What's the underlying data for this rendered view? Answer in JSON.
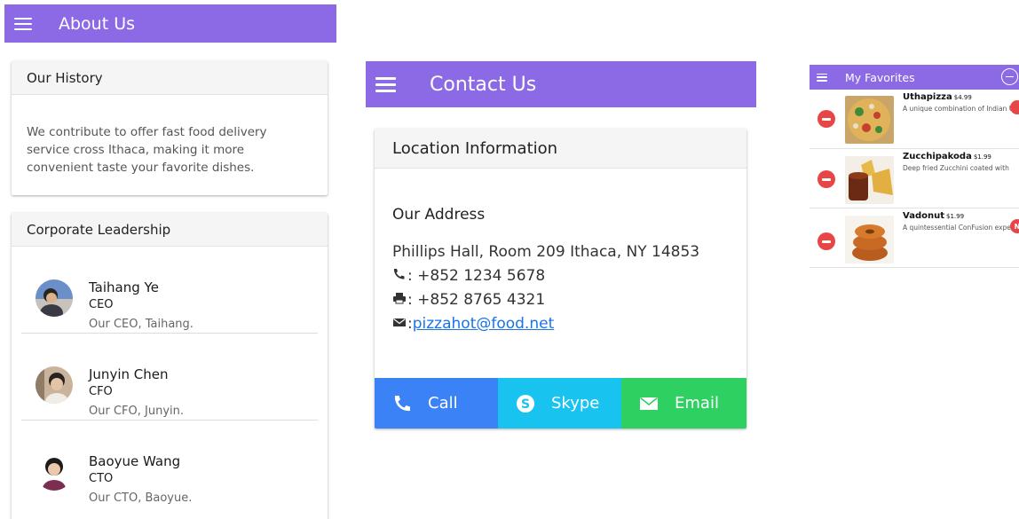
{
  "about": {
    "title": "About Us",
    "history": {
      "header": "Our History",
      "text": "We contribute to offer fast food delivery service cross Ithaca, making it more convenient taste your favorite dishes."
    },
    "leadership": {
      "header": "Corporate Leadership",
      "leaders": [
        {
          "name": "Taihang Ye",
          "role": "CEO",
          "description": "Our CEO, Taihang."
        },
        {
          "name": "Junyin Chen",
          "role": "CFO",
          "description": "Our CFO, Junyin."
        },
        {
          "name": "Baoyue Wang",
          "role": "CTO",
          "description": "Our CTO, Baoyue."
        }
      ]
    }
  },
  "contact": {
    "title": "Contact Us",
    "card_header": "Location Information",
    "address_heading": "Our Address",
    "address": "Phillips Hall, Room 209 Ithaca, NY 14853",
    "phone": ": +852 1234 5678",
    "fax": ": +852 8765 4321",
    "email_prefix": ":",
    "email": "pizzahot@food.net",
    "buttons": {
      "call": "Call",
      "skype": "Skype",
      "email": "Email"
    },
    "colors": {
      "call": "#3b82f6",
      "skype": "#18c3ef",
      "email": "#2ed061"
    }
  },
  "favorites": {
    "title": "My Favorites",
    "items": [
      {
        "name": "Uthapizza",
        "price": "$4.99",
        "description": "A unique combination of Indian Uthappam",
        "badge": ""
      },
      {
        "name": "Zucchipakoda",
        "price": "$1.99",
        "description": "Deep fried Zucchini coated with",
        "badge": ""
      },
      {
        "name": "Vadonut",
        "price": "$1.99",
        "description": "A quintessential ConFusion experience",
        "badge": "N"
      }
    ]
  },
  "theme": {
    "primary": "#8c6ae6",
    "danger": "#e84646"
  }
}
